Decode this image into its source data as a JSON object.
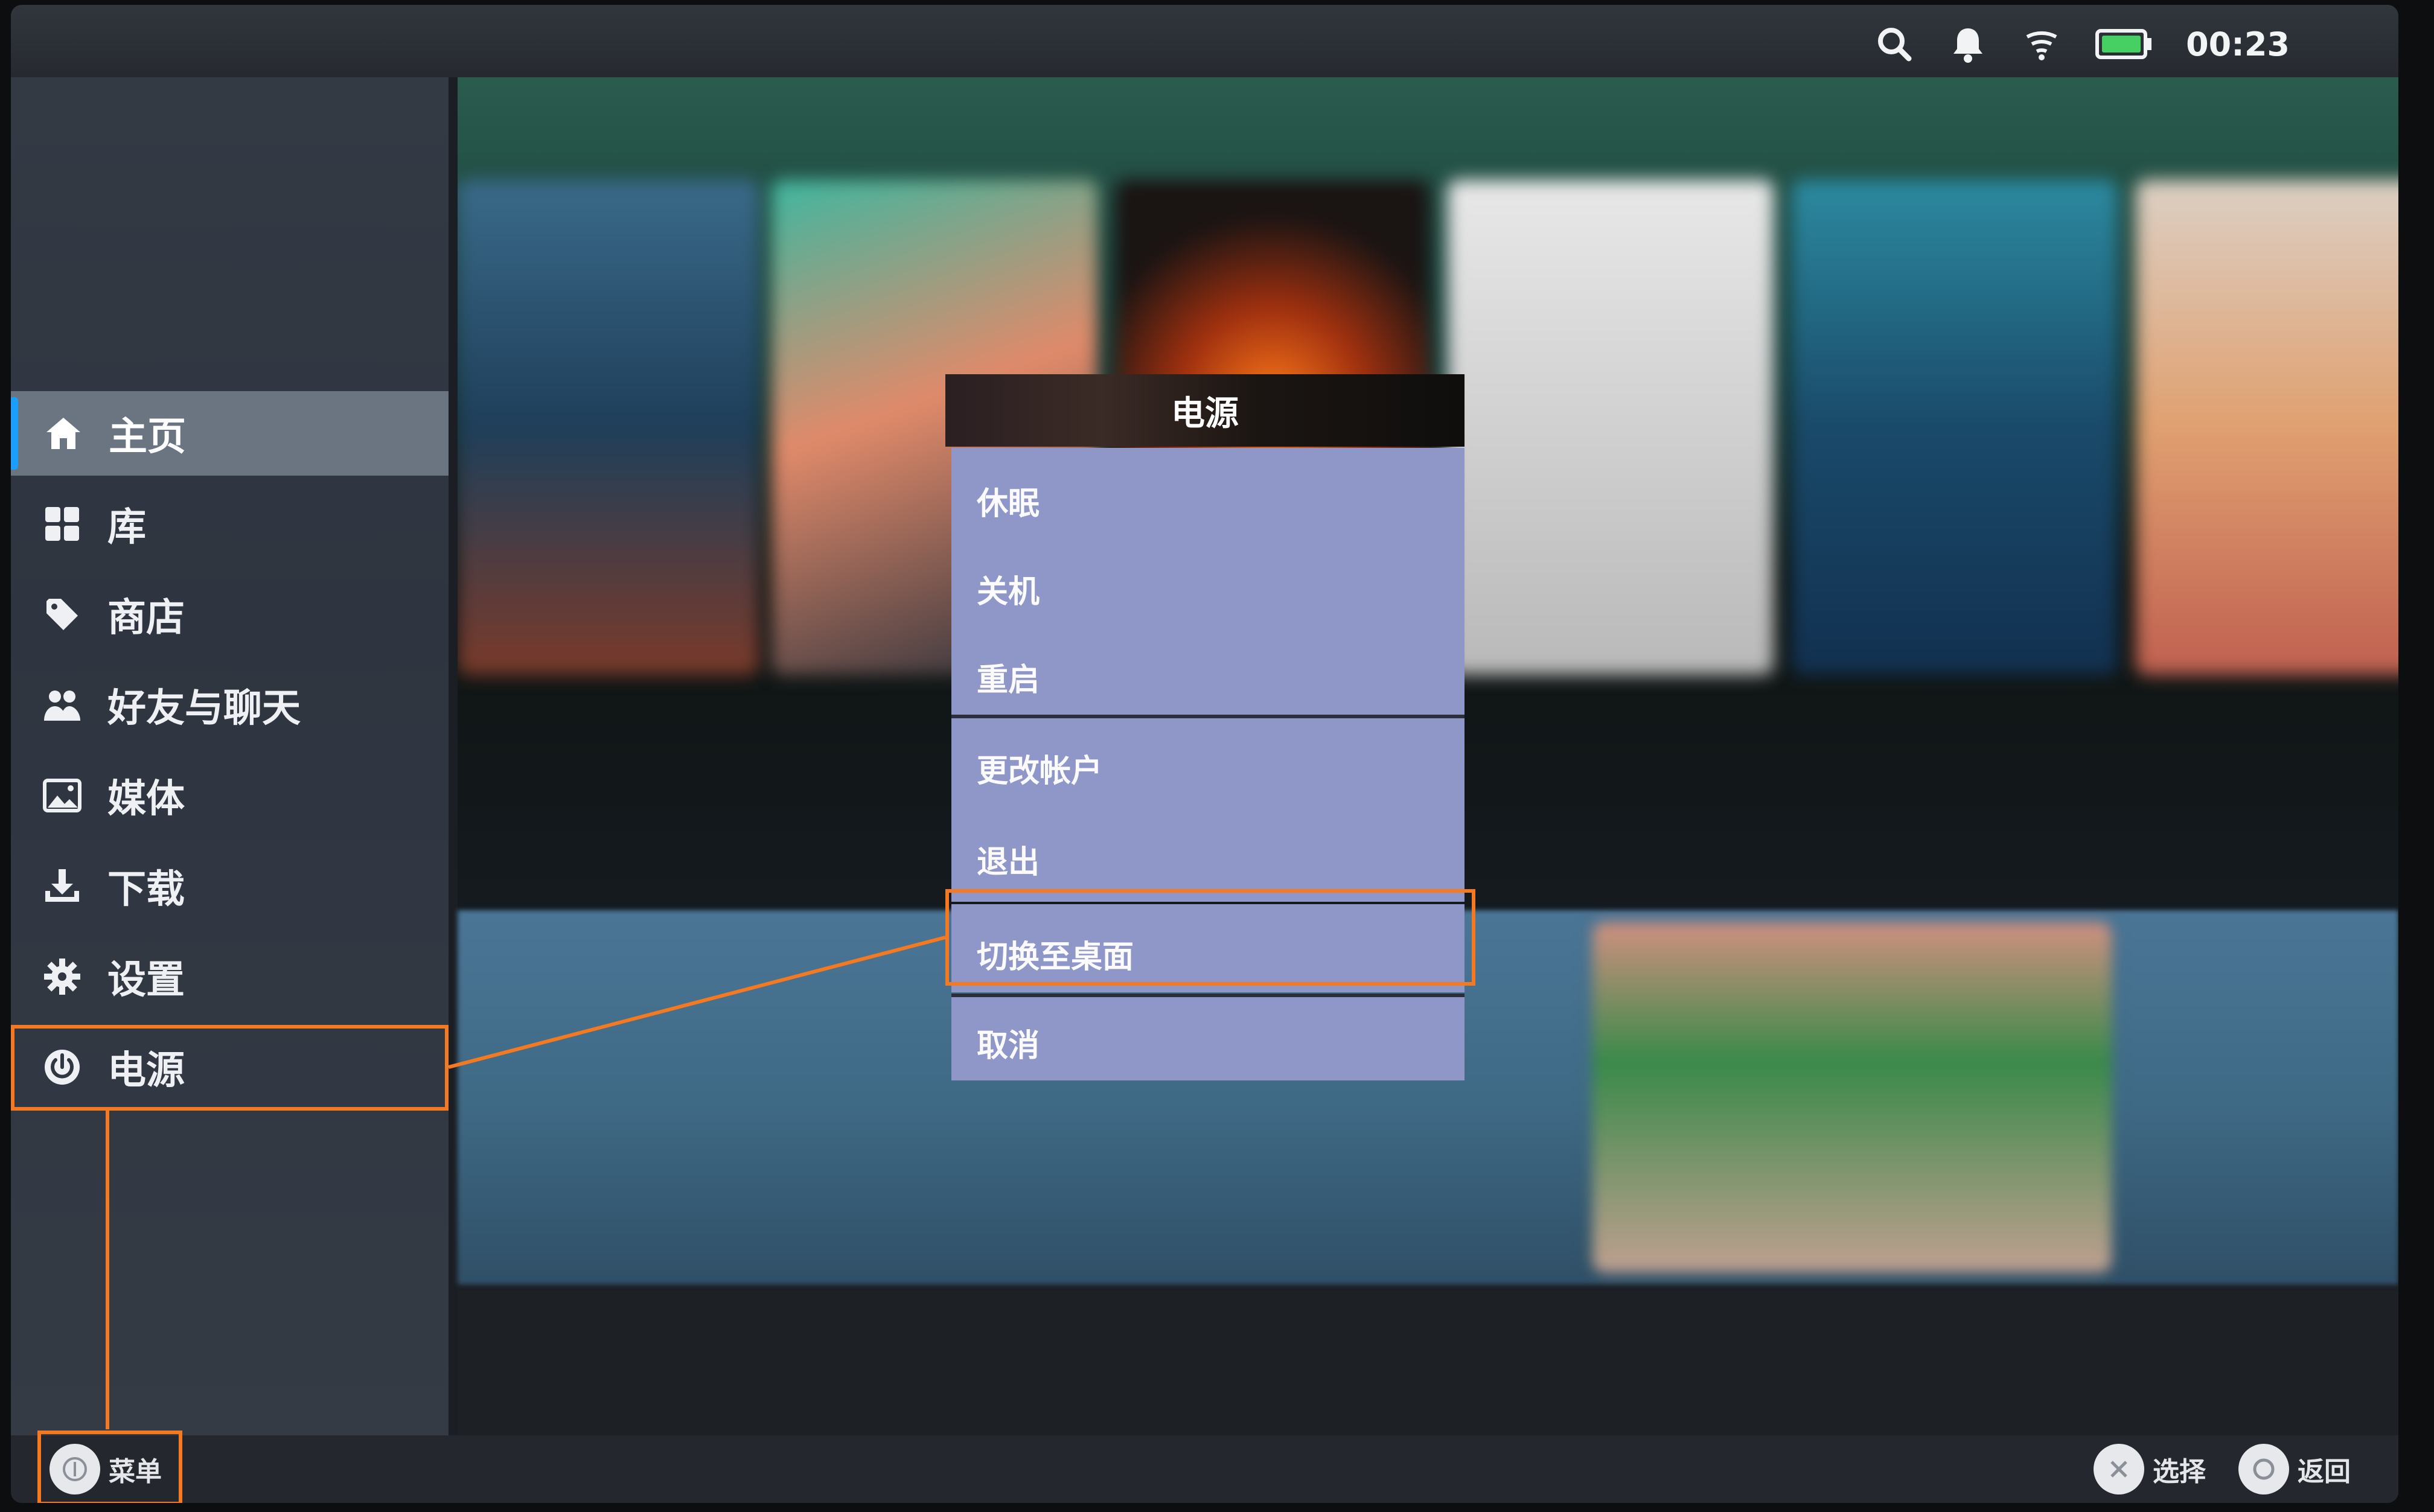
{
  "status_bar": {
    "time": "00:23",
    "icons": [
      "search-icon",
      "notification-bell-icon",
      "wifi-icon",
      "battery-icon"
    ]
  },
  "sidebar": {
    "items": [
      {
        "label": "主页",
        "icon": "home-icon",
        "active": true
      },
      {
        "label": "库",
        "icon": "library-grid-icon"
      },
      {
        "label": "商店",
        "icon": "store-tag-icon"
      },
      {
        "label": "好友与聊天",
        "icon": "friends-icon"
      },
      {
        "label": "媒体",
        "icon": "media-image-icon"
      },
      {
        "label": "下载",
        "icon": "download-icon"
      },
      {
        "label": "设置",
        "icon": "gear-icon"
      },
      {
        "label": "电源",
        "icon": "power-icon",
        "highlighted": true
      }
    ]
  },
  "power_dialog": {
    "title": "电源",
    "group1": [
      "休眠",
      "关机",
      "重启"
    ],
    "group2": [
      "更改帐户",
      "退出"
    ],
    "switch_to_desktop": "切换至桌面",
    "cancel": "取消"
  },
  "bottom_bar": {
    "menu_label": "菜单",
    "select_label": "选择",
    "back_label": "返回"
  },
  "colors": {
    "highlight": "#f47920",
    "menu_bg": "#8f97c8",
    "accent": "#1a9fff"
  }
}
